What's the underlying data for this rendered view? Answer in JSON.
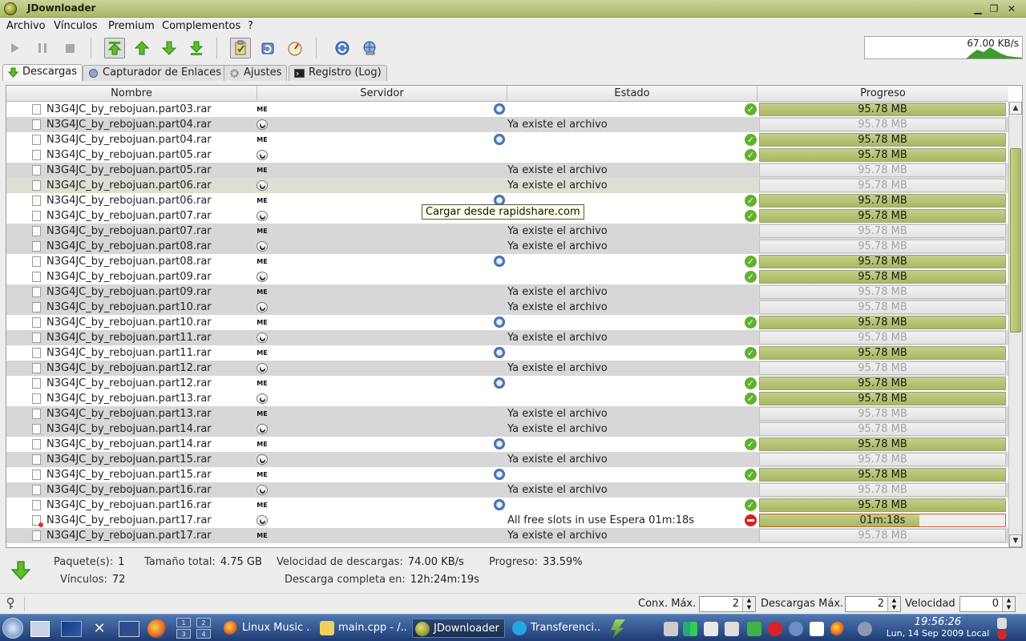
{
  "window": {
    "title": "JDownloader"
  },
  "menu": [
    "Archivo",
    "Vínculos",
    "Premium",
    "Complementos",
    "?"
  ],
  "speed_meter": {
    "text": "67.00 KB/s"
  },
  "tabs": [
    {
      "label": "Descargas",
      "icon": "download-arrow-icon",
      "active": true
    },
    {
      "label": "Capturador de Enlaces",
      "icon": "linkgrabber-icon",
      "active": false
    },
    {
      "label": "Ajustes",
      "icon": "gear-icon",
      "active": false
    },
    {
      "label": "Registro (Log)",
      "icon": "terminal-icon",
      "active": false
    }
  ],
  "table": {
    "headers": [
      "Nombre",
      "Servidor",
      "Estado",
      "Progreso"
    ],
    "rows": [
      {
        "name": "N3G4JC_by_rebojuan.part03.rar",
        "host": "ME",
        "refresh": true,
        "state": "",
        "status": "ok",
        "progress": "95.78 MB",
        "filled": 1.0
      },
      {
        "name": "N3G4JC_by_rebojuan.part04.rar",
        "host": "RS",
        "refresh": false,
        "state": "Ya existe el archivo",
        "status": "",
        "progress": "95.78 MB",
        "filled": 0
      },
      {
        "name": "N3G4JC_by_rebojuan.part04.rar",
        "host": "ME",
        "refresh": true,
        "state": "",
        "status": "ok",
        "progress": "95.78 MB",
        "filled": 1.0
      },
      {
        "name": "N3G4JC_by_rebojuan.part05.rar",
        "host": "RS",
        "refresh": false,
        "state": "",
        "status": "ok",
        "progress": "95.78 MB",
        "filled": 1.0
      },
      {
        "name": "N3G4JC_by_rebojuan.part05.rar",
        "host": "ME",
        "refresh": false,
        "state": "Ya existe el archivo",
        "status": "",
        "progress": "95.78 MB",
        "filled": 0
      },
      {
        "name": "N3G4JC_by_rebojuan.part06.rar",
        "host": "RS",
        "refresh": false,
        "state": "Ya existe el archivo",
        "status": "",
        "progress": "95.78 MB",
        "filled": 0,
        "highlight": true
      },
      {
        "name": "N3G4JC_by_rebojuan.part06.rar",
        "host": "ME",
        "refresh": true,
        "state": "",
        "status": "ok",
        "progress": "95.78 MB",
        "filled": 1.0
      },
      {
        "name": "N3G4JC_by_rebojuan.part07.rar",
        "host": "RS",
        "refresh": false,
        "state": "",
        "status": "ok",
        "progress": "95.78 MB",
        "filled": 1.0
      },
      {
        "name": "N3G4JC_by_rebojuan.part07.rar",
        "host": "ME",
        "refresh": false,
        "state": "Ya existe el archivo",
        "status": "",
        "progress": "95.78 MB",
        "filled": 0
      },
      {
        "name": "N3G4JC_by_rebojuan.part08.rar",
        "host": "RS",
        "refresh": false,
        "state": "Ya existe el archivo",
        "status": "",
        "progress": "95.78 MB",
        "filled": 0
      },
      {
        "name": "N3G4JC_by_rebojuan.part08.rar",
        "host": "ME",
        "refresh": true,
        "state": "",
        "status": "ok",
        "progress": "95.78 MB",
        "filled": 1.0
      },
      {
        "name": "N3G4JC_by_rebojuan.part09.rar",
        "host": "RS",
        "refresh": false,
        "state": "",
        "status": "ok",
        "progress": "95.78 MB",
        "filled": 1.0
      },
      {
        "name": "N3G4JC_by_rebojuan.part09.rar",
        "host": "ME",
        "refresh": false,
        "state": "Ya existe el archivo",
        "status": "",
        "progress": "95.78 MB",
        "filled": 0
      },
      {
        "name": "N3G4JC_by_rebojuan.part10.rar",
        "host": "RS",
        "refresh": false,
        "state": "Ya existe el archivo",
        "status": "",
        "progress": "95.78 MB",
        "filled": 0
      },
      {
        "name": "N3G4JC_by_rebojuan.part10.rar",
        "host": "ME",
        "refresh": true,
        "state": "",
        "status": "ok",
        "progress": "95.78 MB",
        "filled": 1.0
      },
      {
        "name": "N3G4JC_by_rebojuan.part11.rar",
        "host": "RS",
        "refresh": false,
        "state": "Ya existe el archivo",
        "status": "",
        "progress": "95.78 MB",
        "filled": 0
      },
      {
        "name": "N3G4JC_by_rebojuan.part11.rar",
        "host": "ME",
        "refresh": true,
        "state": "",
        "status": "ok",
        "progress": "95.78 MB",
        "filled": 1.0
      },
      {
        "name": "N3G4JC_by_rebojuan.part12.rar",
        "host": "RS",
        "refresh": false,
        "state": "Ya existe el archivo",
        "status": "",
        "progress": "95.78 MB",
        "filled": 0
      },
      {
        "name": "N3G4JC_by_rebojuan.part12.rar",
        "host": "ME",
        "refresh": true,
        "state": "",
        "status": "ok",
        "progress": "95.78 MB",
        "filled": 1.0
      },
      {
        "name": "N3G4JC_by_rebojuan.part13.rar",
        "host": "RS",
        "refresh": false,
        "state": "",
        "status": "ok",
        "progress": "95.78 MB",
        "filled": 1.0
      },
      {
        "name": "N3G4JC_by_rebojuan.part13.rar",
        "host": "ME",
        "refresh": false,
        "state": "Ya existe el archivo",
        "status": "",
        "progress": "95.78 MB",
        "filled": 0
      },
      {
        "name": "N3G4JC_by_rebojuan.part14.rar",
        "host": "RS",
        "refresh": false,
        "state": "Ya existe el archivo",
        "status": "",
        "progress": "95.78 MB",
        "filled": 0
      },
      {
        "name": "N3G4JC_by_rebojuan.part14.rar",
        "host": "ME",
        "refresh": true,
        "state": "",
        "status": "ok",
        "progress": "95.78 MB",
        "filled": 1.0
      },
      {
        "name": "N3G4JC_by_rebojuan.part15.rar",
        "host": "RS",
        "refresh": false,
        "state": "Ya existe el archivo",
        "status": "",
        "progress": "95.78 MB",
        "filled": 0
      },
      {
        "name": "N3G4JC_by_rebojuan.part15.rar",
        "host": "ME",
        "refresh": true,
        "state": "",
        "status": "ok",
        "progress": "95.78 MB",
        "filled": 1.0
      },
      {
        "name": "N3G4JC_by_rebojuan.part16.rar",
        "host": "RS",
        "refresh": false,
        "state": "Ya existe el archivo",
        "status": "",
        "progress": "95.78 MB",
        "filled": 0
      },
      {
        "name": "N3G4JC_by_rebojuan.part16.rar",
        "host": "ME",
        "refresh": true,
        "state": "",
        "status": "ok",
        "progress": "95.78 MB",
        "filled": 1.0
      },
      {
        "name": "N3G4JC_by_rebojuan.part17.rar",
        "host": "RS",
        "refresh": false,
        "state": "All free slots in use Espera 01m:18s",
        "status": "error",
        "progress": "01m:18s",
        "filled": 0.65,
        "file_error": true
      },
      {
        "name": "N3G4JC_by_rebojuan.part17.rar",
        "host": "ME",
        "refresh": false,
        "state": "Ya existe el archivo",
        "status": "",
        "progress": "95.78 MB",
        "filled": 0
      }
    ]
  },
  "tooltip": "Cargar desde rapidshare.com",
  "summary": {
    "packages_label": "Paquete(s):",
    "packages": "1",
    "links_label": "Vínculos:",
    "links": "72",
    "total_size_label": "Tamaño total:",
    "total_size": "4.75 GB",
    "speed_label": "Velocidad de descargas:",
    "speed": "74.00 KB/s",
    "eta_label": "Descarga completa en:",
    "eta": "12h:24m:19s",
    "progress_label": "Progreso:",
    "progress": "33.59%"
  },
  "bottom": {
    "max_conn_label": "Conx. Máx.",
    "max_conn": "2",
    "max_downloads_label": "Descargas Máx.",
    "max_downloads": "2",
    "speed_label": "Velocidad",
    "speed": "0"
  },
  "taskbar": {
    "items": [
      {
        "label": "Linux Music ...",
        "icon": "firefox-icon"
      },
      {
        "label": "main.cpp - /...",
        "icon": "editor-icon"
      },
      {
        "label": "JDownloader",
        "icon": "jdownloader-icon",
        "active": true
      },
      {
        "label": "Transferenci...",
        "icon": "skype-icon"
      }
    ],
    "pager": [
      "1",
      "2",
      "3",
      "4"
    ],
    "clock_time": "19:56:26",
    "clock_date": "Lun, 14 Sep 2009 Local"
  },
  "colors": {
    "progress_fill": "#aebd68",
    "title_bar": "#b5c27a",
    "ok": "#5fb22c",
    "error": "#d42121"
  }
}
